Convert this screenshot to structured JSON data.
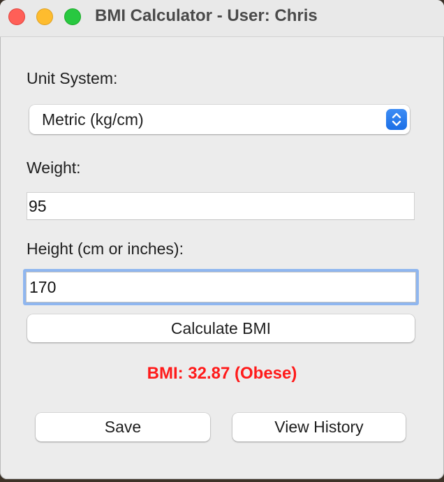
{
  "window": {
    "title": "BMI Calculator - User: Chris"
  },
  "form": {
    "unit_label": "Unit System:",
    "unit_selected": "Metric (kg/cm)",
    "weight_label": "Weight:",
    "weight_value": "95",
    "height_label": "Height (cm or inches):",
    "height_value": "170",
    "calculate_label": "Calculate BMI"
  },
  "result": {
    "text": "BMI: 32.87 (Obese)",
    "color": "#ff1a1a"
  },
  "actions": {
    "save_label": "Save",
    "history_label": "View History"
  },
  "icons": {
    "stepper": "chevron-up-down-icon"
  },
  "colors": {
    "accent": "#1b6fe6",
    "focus_ring": "#8fb6ef",
    "close": "#ff5f57",
    "minimize": "#febc2e",
    "zoom": "#28c840"
  }
}
